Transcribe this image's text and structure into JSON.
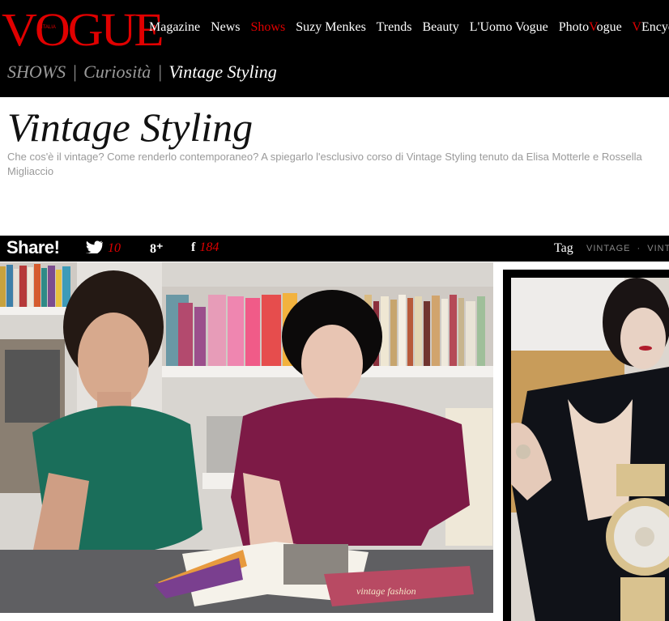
{
  "header": {
    "logo": "VOGUE",
    "logo_sub": "ITALIA",
    "nav": [
      "Magazine",
      "News",
      "Shows",
      "Suzy Menkes",
      "Trends",
      "Beauty",
      "L'Uomo Vogue"
    ],
    "nav_photo_a": "Photo",
    "nav_photo_b": "V",
    "nav_photo_c": "ogue",
    "nav_encyc_a": "V",
    "nav_encyc_b": "Encyclo",
    "active_nav": "Shows"
  },
  "breadcrumb": {
    "section": "SHOWS",
    "sep": "|",
    "category": "Curiosità",
    "current": "Vintage Styling"
  },
  "article": {
    "title": "Vintage Styling",
    "subtitle": "Che cos'è il vintage? Come renderlo contemporaneo? A spiegarlo l'esclusivo corso di Vintage Styling tenuto da Elisa Motterle e Rossella Migliaccio"
  },
  "share": {
    "label": "Share!",
    "twitter_count": "10",
    "gplus_glyph": "8⁺",
    "facebook_glyph": "f",
    "facebook_count": "184",
    "tag_label": "Tag",
    "tags": [
      "VINTAGE",
      "VINTA"
    ]
  },
  "photo": {
    "book_text": "vintage fashion"
  },
  "colors": {
    "brand_red": "#e00000",
    "background": "#000000"
  }
}
